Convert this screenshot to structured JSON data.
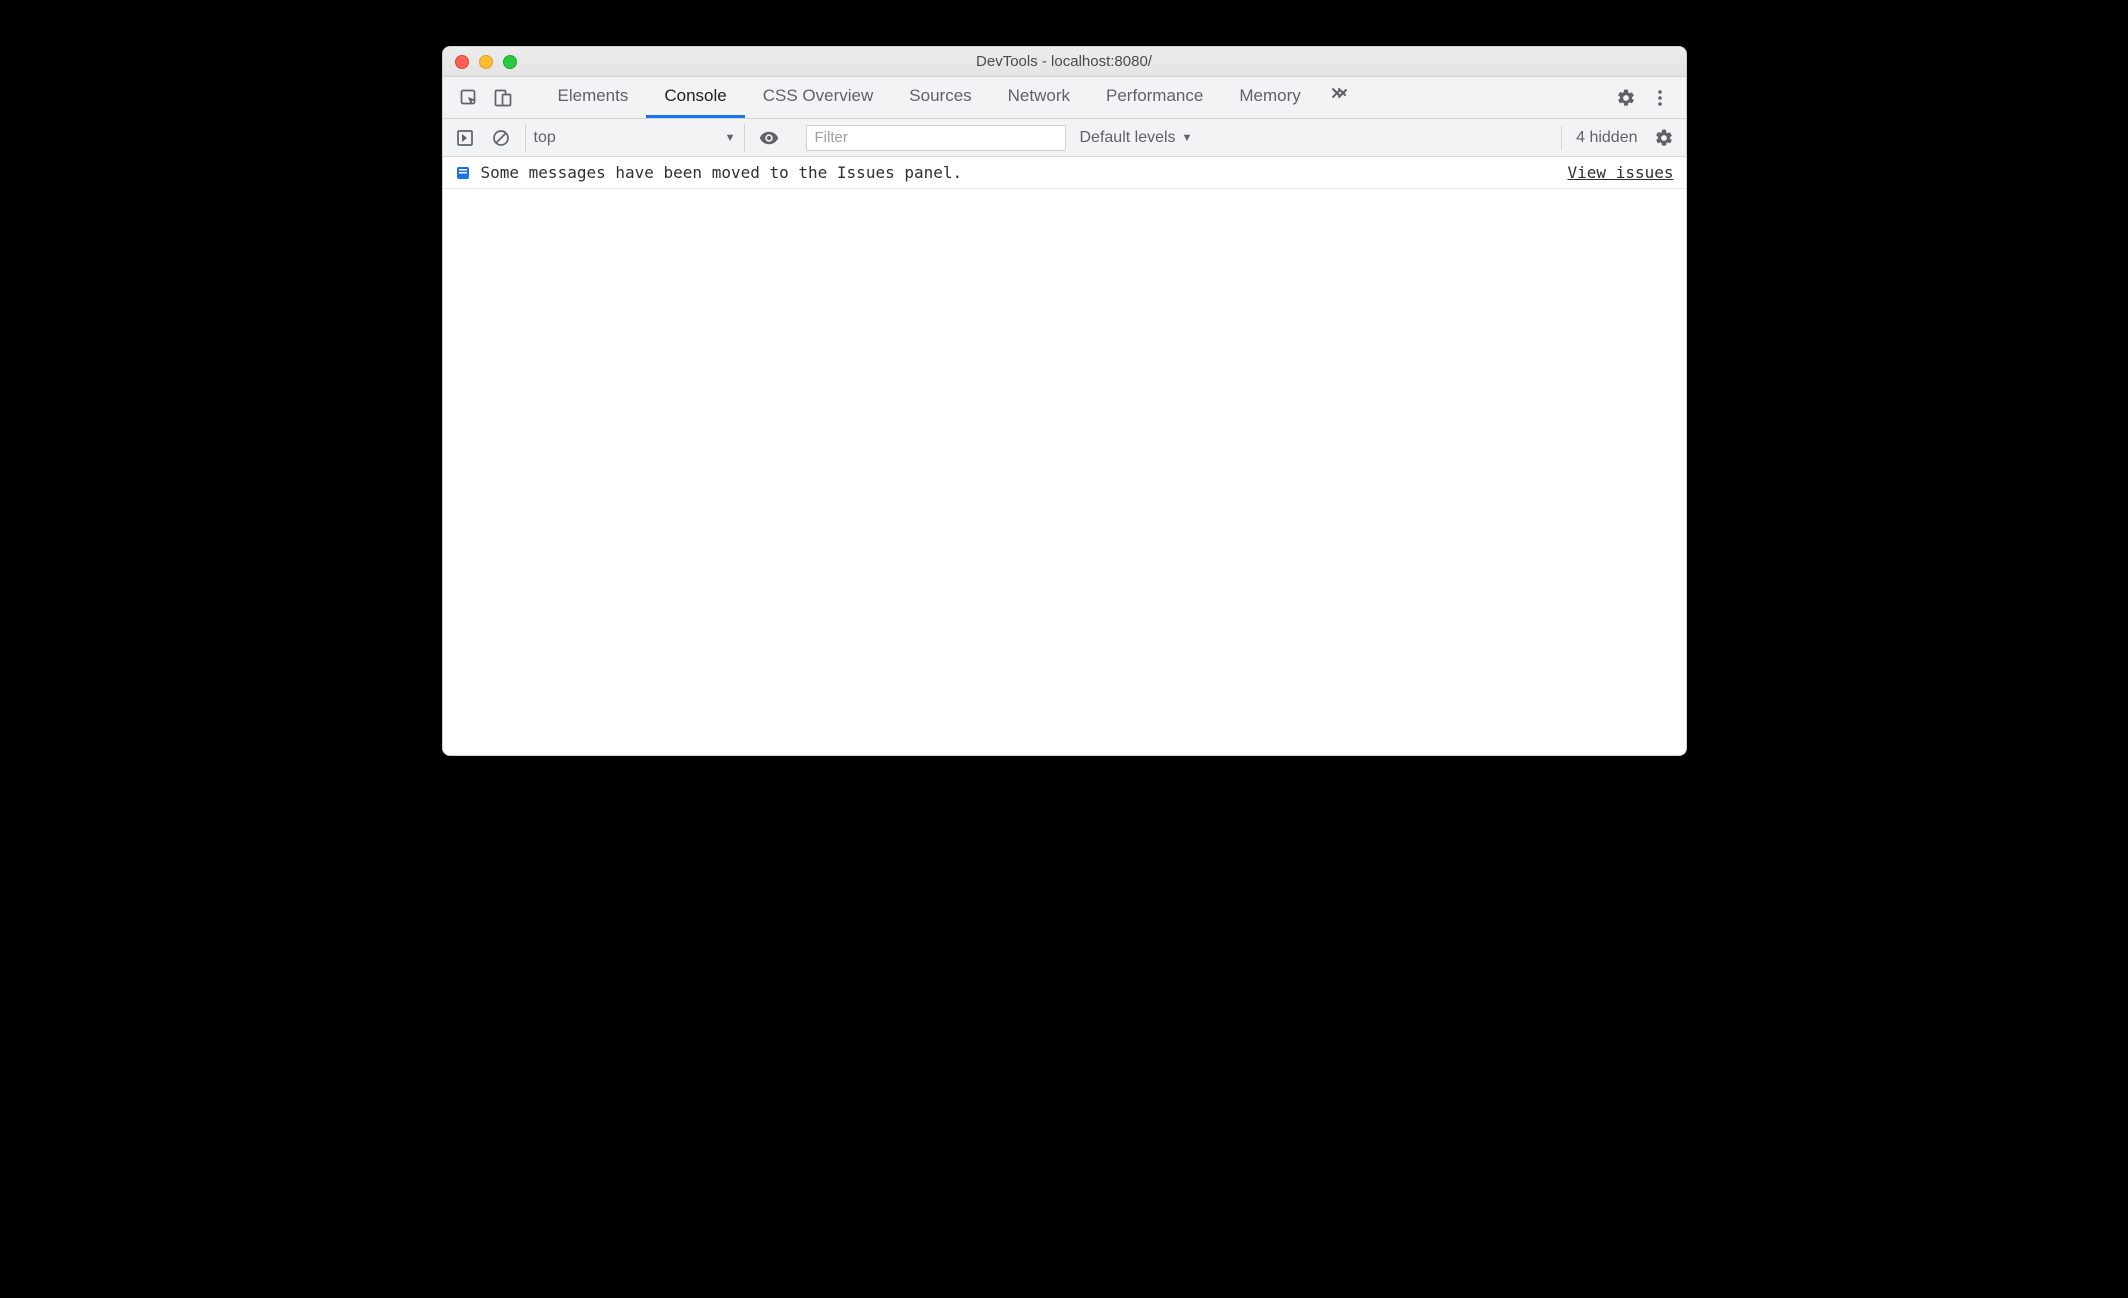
{
  "window": {
    "title": "DevTools - localhost:8080/"
  },
  "tabs": {
    "items": [
      "Elements",
      "Console",
      "CSS Overview",
      "Sources",
      "Network",
      "Performance",
      "Memory"
    ],
    "active": "Console"
  },
  "toolbar": {
    "context": "top",
    "filter_placeholder": "Filter",
    "levels": "Default levels",
    "hidden_count": "4 hidden"
  },
  "message": {
    "text": "Some messages have been moved to the Issues panel.",
    "link": "View issues"
  }
}
